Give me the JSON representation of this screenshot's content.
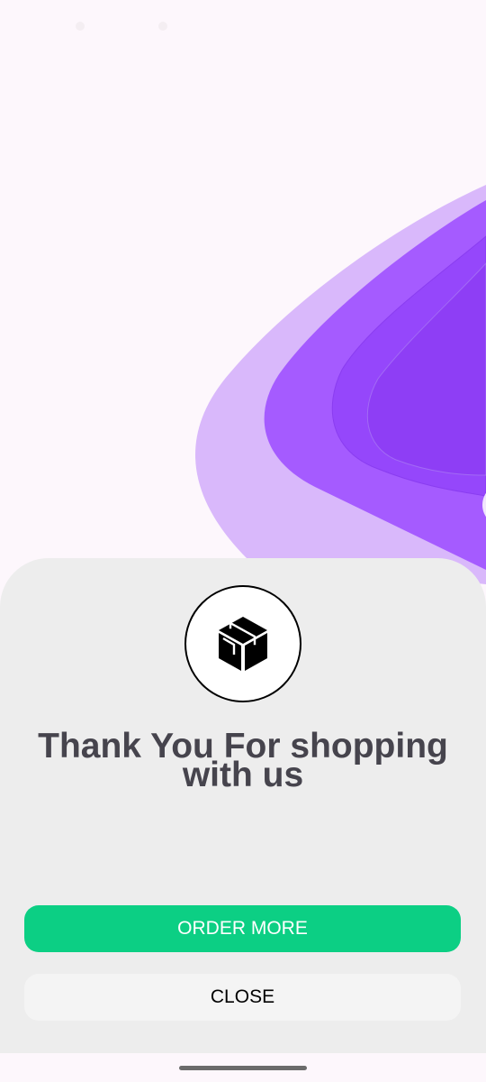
{
  "dialog": {
    "title": "Thank You For shopping with us",
    "icon": "package-box-icon"
  },
  "buttons": {
    "order_more": "ORDER MORE",
    "close": "CLOSE"
  },
  "colors": {
    "background": "#fdf7fc",
    "sheet": "#ededed",
    "accent_green": "#0ccf84",
    "wave_light": "#d9b8fb",
    "wave_mid": "#a55bff",
    "wave_dark": "#8e3ef5",
    "title_text": "#46444d"
  }
}
